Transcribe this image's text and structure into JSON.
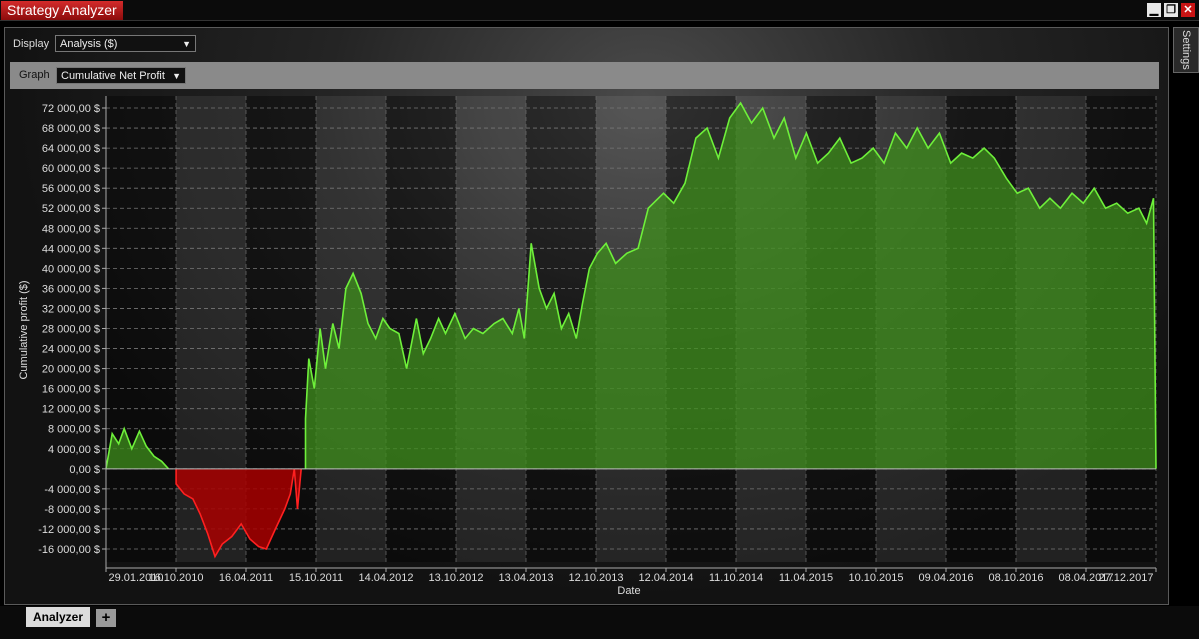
{
  "window": {
    "title": "Strategy Analyzer",
    "controls": [
      "minimize-icon",
      "restore-icon",
      "close-icon"
    ]
  },
  "toolbar": {
    "display_label": "Display",
    "display_value": "Analysis ($)",
    "graph_label": "Graph",
    "graph_value": "Cumulative Net Profit"
  },
  "settings_tab": "Settings",
  "bottom_tabs": {
    "analyzer": "Analyzer",
    "add": "+"
  },
  "colors": {
    "profit_fill": "#3f8f1c",
    "profit_line": "#6ef03a",
    "loss_fill": "#a80000",
    "loss_line": "#ff2020"
  },
  "chart_data": {
    "type": "area",
    "xlabel": "Date",
    "ylabel": "Cumulative profit ($)",
    "ylim": [
      -16000,
      72000
    ],
    "yticks": [
      72000,
      68000,
      64000,
      60000,
      56000,
      52000,
      48000,
      44000,
      40000,
      36000,
      32000,
      28000,
      24000,
      20000,
      16000,
      12000,
      8000,
      4000,
      0,
      -4000,
      -8000,
      -12000,
      -16000
    ],
    "ytick_labels": [
      "72 000,00 $",
      "68 000,00 $",
      "64 000,00 $",
      "60 000,00 $",
      "56 000,00 $",
      "52 000,00 $",
      "48 000,00 $",
      "44 000,00 $",
      "40 000,00 $",
      "36 000,00 $",
      "32 000,00 $",
      "28 000,00 $",
      "24 000,00 $",
      "20 000,00 $",
      "16 000,00 $",
      "12 000,00 $",
      "8 000,00 $",
      "4 000,00 $",
      "0,00 $",
      "-4 000,00 $",
      "-8 000,00 $",
      "-12 000,00 $",
      "-16 000,00 $"
    ],
    "xtick_labels": [
      "29.01.2010",
      "16.10.2010",
      "16.04.2011",
      "15.10.2011",
      "14.04.2012",
      "13.10.2012",
      "13.04.2013",
      "12.10.2013",
      "12.04.2014",
      "11.10.2014",
      "11.04.2015",
      "10.10.2015",
      "09.04.2016",
      "08.10.2016",
      "08.04.2017",
      "27.12.2017"
    ],
    "grid": true,
    "x_date_range": [
      "2010-01-29",
      "2017-12-27"
    ],
    "points": [
      [
        "2010-01-29",
        0
      ],
      [
        "2010-02-15",
        7000
      ],
      [
        "2010-03-05",
        5000
      ],
      [
        "2010-03-20",
        8000
      ],
      [
        "2010-04-10",
        4000
      ],
      [
        "2010-05-01",
        7500
      ],
      [
        "2010-05-20",
        4500
      ],
      [
        "2010-06-10",
        2500
      ],
      [
        "2010-07-01",
        1500
      ],
      [
        "2010-07-20",
        0
      ],
      [
        "2010-08-10",
        -3000
      ],
      [
        "2010-09-01",
        -5000
      ],
      [
        "2010-09-25",
        -6000
      ],
      [
        "2010-10-15",
        -9000
      ],
      [
        "2010-11-05",
        -13000
      ],
      [
        "2010-11-25",
        -17500
      ],
      [
        "2010-12-15",
        -15000
      ],
      [
        "2011-01-10",
        -13500
      ],
      [
        "2011-02-05",
        -11000
      ],
      [
        "2011-03-01",
        -14000
      ],
      [
        "2011-03-25",
        -15500
      ],
      [
        "2011-04-15",
        -16000
      ],
      [
        "2011-05-10",
        -12000
      ],
      [
        "2011-06-05",
        -8000
      ],
      [
        "2011-06-20",
        -5000
      ],
      [
        "2011-07-01",
        0
      ],
      [
        "2011-07-10",
        -8000
      ],
      [
        "2011-07-20",
        0
      ],
      [
        "2011-08-01",
        10000
      ],
      [
        "2011-08-10",
        22000
      ],
      [
        "2011-08-25",
        16000
      ],
      [
        "2011-09-10",
        28000
      ],
      [
        "2011-09-25",
        20000
      ],
      [
        "2011-10-15",
        29000
      ],
      [
        "2011-11-01",
        24000
      ],
      [
        "2011-11-20",
        36000
      ],
      [
        "2011-12-10",
        39000
      ],
      [
        "2012-01-01",
        35000
      ],
      [
        "2012-01-20",
        29000
      ],
      [
        "2012-02-10",
        26000
      ],
      [
        "2012-03-01",
        30000
      ],
      [
        "2012-03-20",
        28000
      ],
      [
        "2012-04-14",
        27000
      ],
      [
        "2012-05-05",
        20000
      ],
      [
        "2012-06-01",
        30000
      ],
      [
        "2012-06-20",
        23000
      ],
      [
        "2012-07-10",
        26000
      ],
      [
        "2012-08-01",
        30000
      ],
      [
        "2012-08-20",
        27000
      ],
      [
        "2012-09-15",
        31000
      ],
      [
        "2012-10-13",
        26000
      ],
      [
        "2012-11-05",
        28000
      ],
      [
        "2012-12-01",
        27000
      ],
      [
        "2013-01-01",
        29000
      ],
      [
        "2013-01-25",
        30000
      ],
      [
        "2013-02-20",
        27000
      ],
      [
        "2013-03-10",
        32000
      ],
      [
        "2013-03-25",
        26000
      ],
      [
        "2013-04-13",
        45000
      ],
      [
        "2013-05-05",
        36000
      ],
      [
        "2013-05-25",
        32000
      ],
      [
        "2013-06-15",
        35000
      ],
      [
        "2013-07-05",
        28000
      ],
      [
        "2013-07-25",
        31000
      ],
      [
        "2013-08-15",
        26000
      ],
      [
        "2013-09-01",
        33000
      ],
      [
        "2013-09-20",
        40000
      ],
      [
        "2013-10-12",
        43000
      ],
      [
        "2013-11-05",
        45000
      ],
      [
        "2013-12-01",
        41000
      ],
      [
        "2014-01-01",
        43000
      ],
      [
        "2014-02-01",
        44000
      ],
      [
        "2014-03-01",
        52000
      ],
      [
        "2014-04-12",
        55000
      ],
      [
        "2014-05-10",
        53000
      ],
      [
        "2014-06-10",
        57000
      ],
      [
        "2014-07-10",
        66000
      ],
      [
        "2014-08-10",
        68000
      ],
      [
        "2014-09-10",
        62000
      ],
      [
        "2014-10-11",
        70000
      ],
      [
        "2014-11-10",
        73000
      ],
      [
        "2014-12-10",
        69000
      ],
      [
        "2015-01-10",
        72000
      ],
      [
        "2015-02-10",
        66000
      ],
      [
        "2015-03-10",
        70000
      ],
      [
        "2015-04-11",
        62000
      ],
      [
        "2015-05-10",
        67000
      ],
      [
        "2015-06-10",
        61000
      ],
      [
        "2015-07-10",
        63000
      ],
      [
        "2015-08-10",
        66000
      ],
      [
        "2015-09-10",
        61000
      ],
      [
        "2015-10-10",
        62000
      ],
      [
        "2015-11-10",
        64000
      ],
      [
        "2015-12-10",
        61000
      ],
      [
        "2016-01-10",
        67000
      ],
      [
        "2016-02-10",
        64000
      ],
      [
        "2016-03-10",
        68000
      ],
      [
        "2016-04-09",
        64000
      ],
      [
        "2016-05-10",
        67000
      ],
      [
        "2016-06-10",
        61000
      ],
      [
        "2016-07-10",
        63000
      ],
      [
        "2016-08-10",
        62000
      ],
      [
        "2016-09-10",
        64000
      ],
      [
        "2016-10-08",
        62000
      ],
      [
        "2016-11-10",
        58000
      ],
      [
        "2016-12-10",
        55000
      ],
      [
        "2017-01-10",
        56000
      ],
      [
        "2017-02-10",
        52000
      ],
      [
        "2017-03-10",
        54000
      ],
      [
        "2017-04-08",
        52000
      ],
      [
        "2017-05-10",
        55000
      ],
      [
        "2017-06-10",
        53000
      ],
      [
        "2017-07-10",
        56000
      ],
      [
        "2017-08-10",
        52000
      ],
      [
        "2017-09-10",
        53000
      ],
      [
        "2017-10-10",
        51000
      ],
      [
        "2017-11-10",
        52000
      ],
      [
        "2017-12-01",
        49000
      ],
      [
        "2017-12-20",
        54000
      ],
      [
        "2017-12-27",
        0
      ]
    ]
  }
}
